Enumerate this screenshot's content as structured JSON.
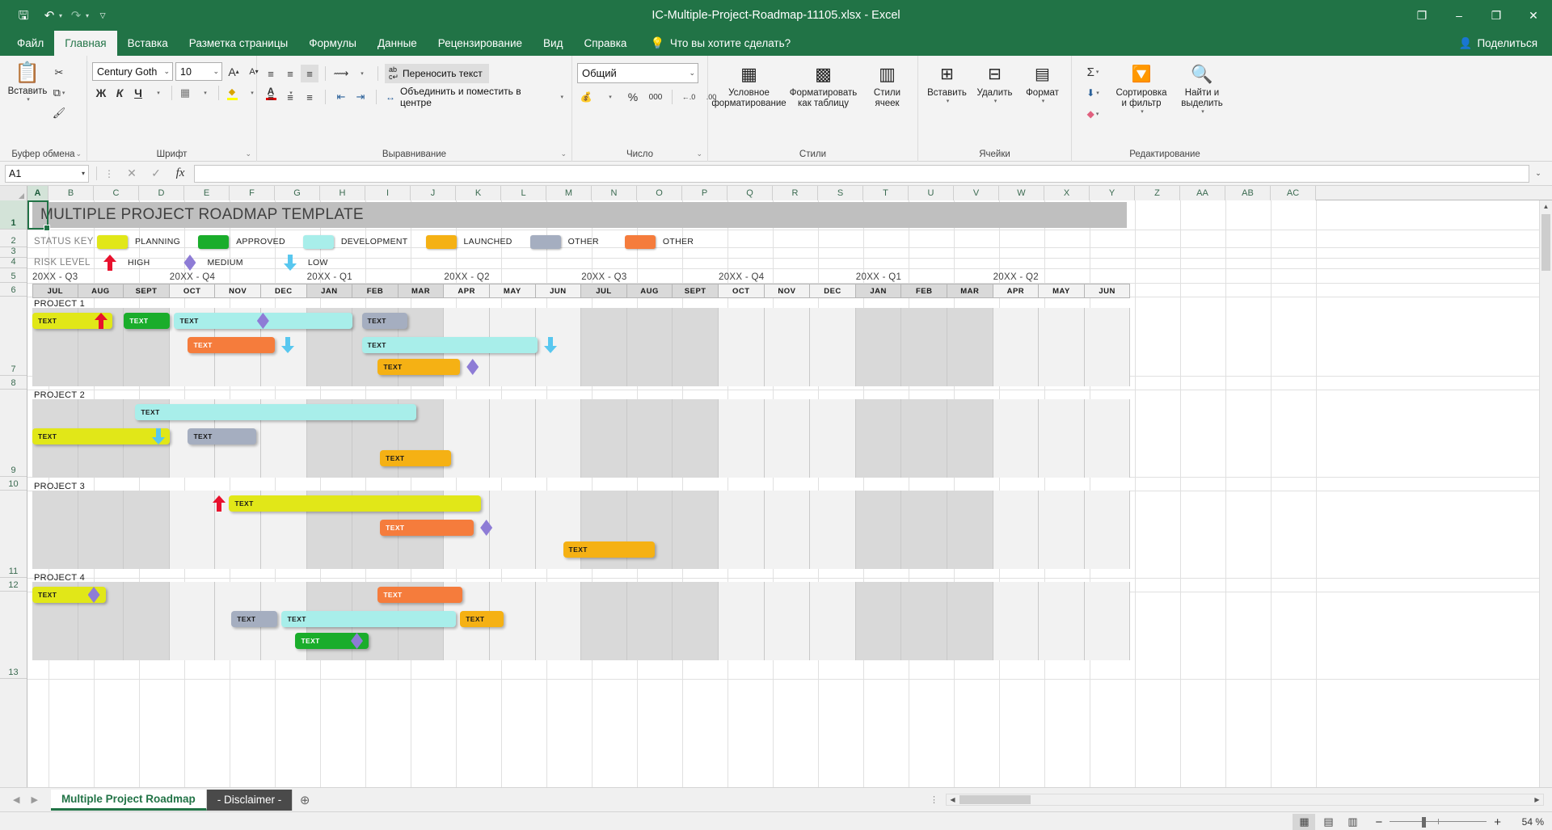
{
  "window": {
    "title": "IC-Multiple-Project-Roadmap-11105.xlsx  -  Excel",
    "minimize": "–",
    "restore": "❐",
    "close": "✕",
    "ribbon_display": "❐"
  },
  "quick_access": {
    "save": "🖫",
    "undo": "↶",
    "redo": "↷",
    "customize": "▽"
  },
  "tabs": [
    {
      "label": "Файл",
      "active": false
    },
    {
      "label": "Главная",
      "active": true
    },
    {
      "label": "Вставка",
      "active": false
    },
    {
      "label": "Разметка страницы",
      "active": false
    },
    {
      "label": "Формулы",
      "active": false
    },
    {
      "label": "Данные",
      "active": false
    },
    {
      "label": "Рецензирование",
      "active": false
    },
    {
      "label": "Вид",
      "active": false
    },
    {
      "label": "Справка",
      "active": false
    }
  ],
  "tell_me": "Что вы хотите сделать?",
  "share": "Поделиться",
  "ribbon": {
    "groups": [
      {
        "name": "Буфер обмена"
      },
      {
        "name": "Шрифт"
      },
      {
        "name": "Выравнивание"
      },
      {
        "name": "Число"
      },
      {
        "name": "Стили"
      },
      {
        "name": "Ячейки"
      },
      {
        "name": "Редактирование"
      }
    ],
    "clipboard": {
      "paste": "Вставить",
      "cut_icon": "✂",
      "copy_icon": "⧉",
      "format_painter_icon": "🖌"
    },
    "font": {
      "font_name": "Century Goth",
      "font_size": "10",
      "grow": "A",
      "shrink": "A",
      "bold": "Ж",
      "italic": "К",
      "underline": "Ч",
      "borders_icon": "▦",
      "fill_icon": "◆",
      "fill_color": "#ffff00",
      "font_color_letter": "A",
      "font_color": "#e00000"
    },
    "alignment": {
      "top": "≡",
      "middle": "≡",
      "bottom": "≡",
      "orientation_icon": "⟿",
      "wrap_text": "Переносить текст",
      "left": "≡",
      "center": "≡",
      "right": "≡",
      "decrease_indent": "⇤",
      "increase_indent": "⇥",
      "merge_center": "Объединить и поместить в центре"
    },
    "number": {
      "format": "Общий",
      "accounting_icon": "💰",
      "percent": "%",
      "comma": "000",
      "inc_decimal": "←.0",
      "dec_decimal": ".00"
    },
    "styles": {
      "conditional": "Условное форматирование",
      "as_table": "Форматировать как таблицу",
      "cell_styles": "Стили ячеек"
    },
    "cells": {
      "insert": "Вставить",
      "delete": "Удалить",
      "format": "Формат"
    },
    "editing": {
      "autosum": "Σ",
      "fill": "⬇",
      "clear": "◆",
      "sort_filter": "Сортировка и фильтр",
      "find_select": "Найти и выделить"
    }
  },
  "formula_bar": {
    "name_box": "A1",
    "cancel": "✕",
    "enter": "✓",
    "fx": "fx",
    "value": "",
    "expand": "⌄"
  },
  "grid": {
    "columns": [
      "A",
      "B",
      "C",
      "D",
      "E",
      "F",
      "G",
      "H",
      "I",
      "J",
      "K",
      "L",
      "M",
      "N",
      "O",
      "P",
      "Q",
      "R",
      "S",
      "T",
      "U",
      "V",
      "W",
      "X",
      "Y",
      "Z",
      "AA",
      "AB",
      "AC"
    ],
    "rows": [
      "1",
      "2",
      "3",
      "4",
      "5",
      "6",
      "7",
      "8",
      "9",
      "10",
      "11",
      "12",
      "13"
    ],
    "selected_cell": "A1"
  },
  "template": {
    "title": "MULTIPLE PROJECT ROADMAP TEMPLATE",
    "status_key_label": "STATUS KEY",
    "risk_level_label": "RISK LEVEL",
    "status_key": [
      {
        "label": "PLANNING",
        "color": "#e1e718"
      },
      {
        "label": "APPROVED",
        "color": "#1aad2b"
      },
      {
        "label": "DEVELOPMENT",
        "color": "#a8eeea"
      },
      {
        "label": "LAUNCHED",
        "color": "#f5b114"
      },
      {
        "label": "OTHER",
        "color": "#a5aec0"
      },
      {
        "label": "OTHER",
        "color": "#f57c3c"
      }
    ],
    "risk_levels": [
      {
        "label": "HIGH",
        "icon": "arrow-up-red",
        "color": "#e8112d"
      },
      {
        "label": "MEDIUM",
        "icon": "diamond-purple",
        "color": "#8e7cd6"
      },
      {
        "label": "LOW",
        "icon": "arrow-down-blue",
        "color": "#58c7ef"
      }
    ],
    "quarters": [
      {
        "label": "20XX - Q3",
        "col": 0
      },
      {
        "label": "20XX - Q4",
        "col": 3
      },
      {
        "label": "20XX - Q1",
        "col": 6
      },
      {
        "label": "20XX - Q2",
        "col": 9
      },
      {
        "label": "20XX - Q3",
        "col": 12
      },
      {
        "label": "20XX - Q4",
        "col": 15
      },
      {
        "label": "20XX - Q1",
        "col": 18
      },
      {
        "label": "20XX - Q2",
        "col": 21
      }
    ],
    "months": [
      "JUL",
      "AUG",
      "SEPT",
      "OCT",
      "NOV",
      "DEC",
      "JAN",
      "FEB",
      "MAR",
      "APR",
      "MAY",
      "JUN",
      "JUL",
      "AUG",
      "SEPT",
      "OCT",
      "NOV",
      "DEC",
      "JAN",
      "FEB",
      "MAR",
      "APR",
      "MAY",
      "JUN"
    ],
    "bar_text": "TEXT",
    "projects": [
      {
        "label": "PROJECT 1",
        "bars": [
          {
            "text": "TEXT",
            "color": "#e1e718",
            "start": 0.0,
            "span": 1.75,
            "lane": 0,
            "marker": "arrow-up-red",
            "marker_pos": "end"
          },
          {
            "text": "TEXT",
            "color": "#1aad2b",
            "start": 2.0,
            "span": 1.0,
            "lane": 0,
            "marker": null,
            "marker_pos": null
          },
          {
            "text": "TEXT",
            "color": "#a8eeea",
            "start": 3.1,
            "span": 3.9,
            "lane": 0,
            "marker": "diamond-purple",
            "marker_pos": "mid"
          },
          {
            "text": "TEXT",
            "color": "#a5aec0",
            "start": 7.2,
            "span": 1.0,
            "lane": 0,
            "marker": null,
            "marker_pos": null
          },
          {
            "text": "TEXT",
            "color": "#f57c3c",
            "start": 3.4,
            "span": 1.9,
            "lane": 1,
            "marker": "arrow-down-blue",
            "marker_pos": "after"
          },
          {
            "text": "TEXT",
            "color": "#a8eeea",
            "start": 7.2,
            "span": 3.85,
            "lane": 1,
            "marker": "arrow-down-blue",
            "marker_pos": "after"
          },
          {
            "text": "TEXT",
            "color": "#f5b114",
            "start": 7.55,
            "span": 1.8,
            "lane": 2,
            "marker": "diamond-purple",
            "marker_pos": "after"
          }
        ]
      },
      {
        "label": "PROJECT 2",
        "bars": [
          {
            "text": "TEXT",
            "color": "#a8eeea",
            "start": 2.25,
            "span": 6.15,
            "lane": 0,
            "marker": null,
            "marker_pos": null
          },
          {
            "text": "TEXT",
            "color": "#e1e718",
            "start": 0.0,
            "span": 3.0,
            "lane": 1,
            "marker": "arrow-down-blue",
            "marker_pos": "end"
          },
          {
            "text": "TEXT",
            "color": "#a5aec0",
            "start": 3.4,
            "span": 1.5,
            "lane": 1,
            "marker": null,
            "marker_pos": null
          },
          {
            "text": "TEXT",
            "color": "#f5b114",
            "start": 7.6,
            "span": 1.55,
            "lane": 2,
            "marker": null,
            "marker_pos": null
          }
        ]
      },
      {
        "label": "PROJECT 3",
        "bars": [
          {
            "text": "TEXT",
            "color": "#e1e718",
            "start": 4.3,
            "span": 5.5,
            "lane": 0,
            "marker": "arrow-up-red",
            "marker_pos": "before"
          },
          {
            "text": "TEXT",
            "color": "#f57c3c",
            "start": 7.6,
            "span": 2.05,
            "lane": 1,
            "marker": "diamond-purple",
            "marker_pos": "after"
          },
          {
            "text": "TEXT",
            "color": "#f5b114",
            "start": 11.6,
            "span": 2.0,
            "lane": 2,
            "marker": null,
            "marker_pos": null
          }
        ]
      },
      {
        "label": "PROJECT 4",
        "bars": [
          {
            "text": "TEXT",
            "color": "#e1e718",
            "start": 0.0,
            "span": 1.6,
            "lane": 0,
            "marker": "diamond-purple",
            "marker_pos": "end"
          },
          {
            "text": "TEXT",
            "color": "#f57c3c",
            "start": 7.55,
            "span": 1.85,
            "lane": 0,
            "marker": null,
            "marker_pos": null
          },
          {
            "text": "TEXT",
            "color": "#a5aec0",
            "start": 4.35,
            "span": 1.0,
            "lane": 1,
            "marker": null,
            "marker_pos": null
          },
          {
            "text": "TEXT",
            "color": "#a8eeea",
            "start": 5.45,
            "span": 3.8,
            "lane": 1,
            "marker": null,
            "marker_pos": null
          },
          {
            "text": "TEXT",
            "color": "#f5b114",
            "start": 9.35,
            "span": 0.95,
            "lane": 1,
            "marker": null,
            "marker_pos": null
          },
          {
            "text": "TEXT",
            "color": "#1aad2b",
            "start": 5.75,
            "span": 1.6,
            "lane": 2,
            "marker": "diamond-purple",
            "marker_pos": "end"
          }
        ]
      }
    ]
  },
  "sheet_tabs": [
    {
      "label": "Multiple Project Roadmap",
      "active": true
    },
    {
      "label": "- Disclaimer -",
      "active": false
    }
  ],
  "add_sheet": "⊕",
  "status": {
    "view_normal": "▦",
    "view_layout": "▤",
    "view_break": "▥",
    "zoom_out": "−",
    "zoom_in": "+",
    "zoom_level": "54 %"
  }
}
